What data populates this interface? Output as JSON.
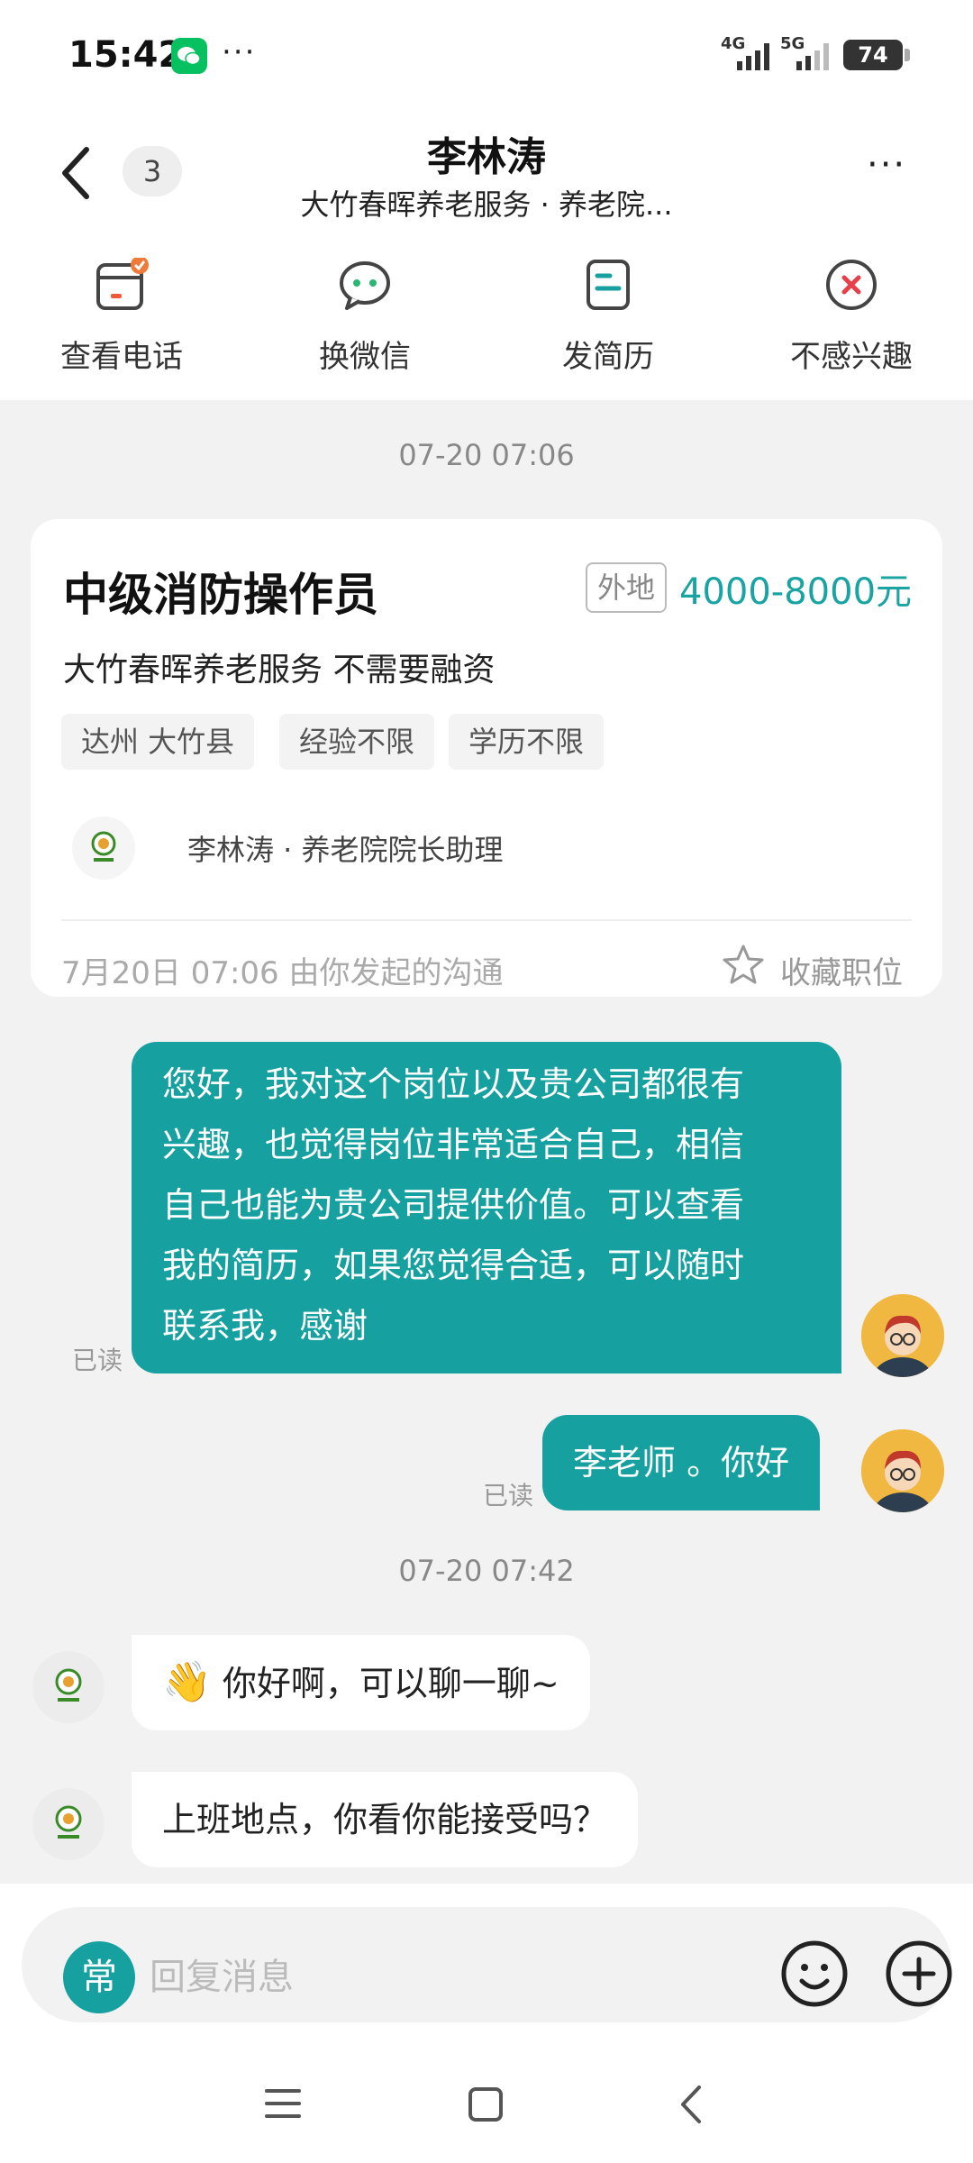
{
  "status_bar": {
    "time": "15:42",
    "net1": "4G",
    "net2": "5G",
    "battery": "74",
    "more": "···"
  },
  "header": {
    "title": "李林涛",
    "subtitle": "大竹春晖养老服务 · 养老院...",
    "unread_count": "3",
    "more": "···"
  },
  "actions": [
    {
      "label": "查看电话",
      "icon": "phone-card-icon"
    },
    {
      "label": "换微信",
      "icon": "wechat-icon"
    },
    {
      "label": "发简历",
      "icon": "resume-icon"
    },
    {
      "label": "不感兴趣",
      "icon": "not-interested-icon"
    }
  ],
  "chat": {
    "timestamp1": "07-20 07:06",
    "job_card": {
      "title": "中级消防操作员",
      "remote_tag": "外地",
      "salary": "4000-8000元",
      "company": "大竹春晖养老服务  不需要融资",
      "tags": [
        "达州 大竹县",
        "经验不限",
        "学历不限"
      ],
      "recruiter": "李林涛 · 养老院院长助理",
      "initiated": "7月20日 07:06 由你发起的沟通",
      "favorite_label": "收藏职位"
    },
    "message1_lines": [
      "您好，我对这个岗位以及贵公司都很有",
      "兴趣，也觉得岗位非常适合自己，相信",
      "自己也能为贵公司提供价值。可以查看",
      "我的简历，如果您觉得合适，可以随时",
      "联系我，感谢"
    ],
    "read_label": "已读",
    "message2": "李老师 。你好",
    "timestamp2": "07-20 07:42",
    "reply1": "你好啊，可以聊一聊~",
    "reply1_emoji": "👋",
    "reply2": "上班地点，你看你能接受吗？"
  },
  "input": {
    "quick_label": "常",
    "placeholder": "回复消息"
  },
  "colors": {
    "accent": "#16a0a0",
    "salary": "#1aa3a3",
    "chat_bg": "#f2f2f2"
  }
}
